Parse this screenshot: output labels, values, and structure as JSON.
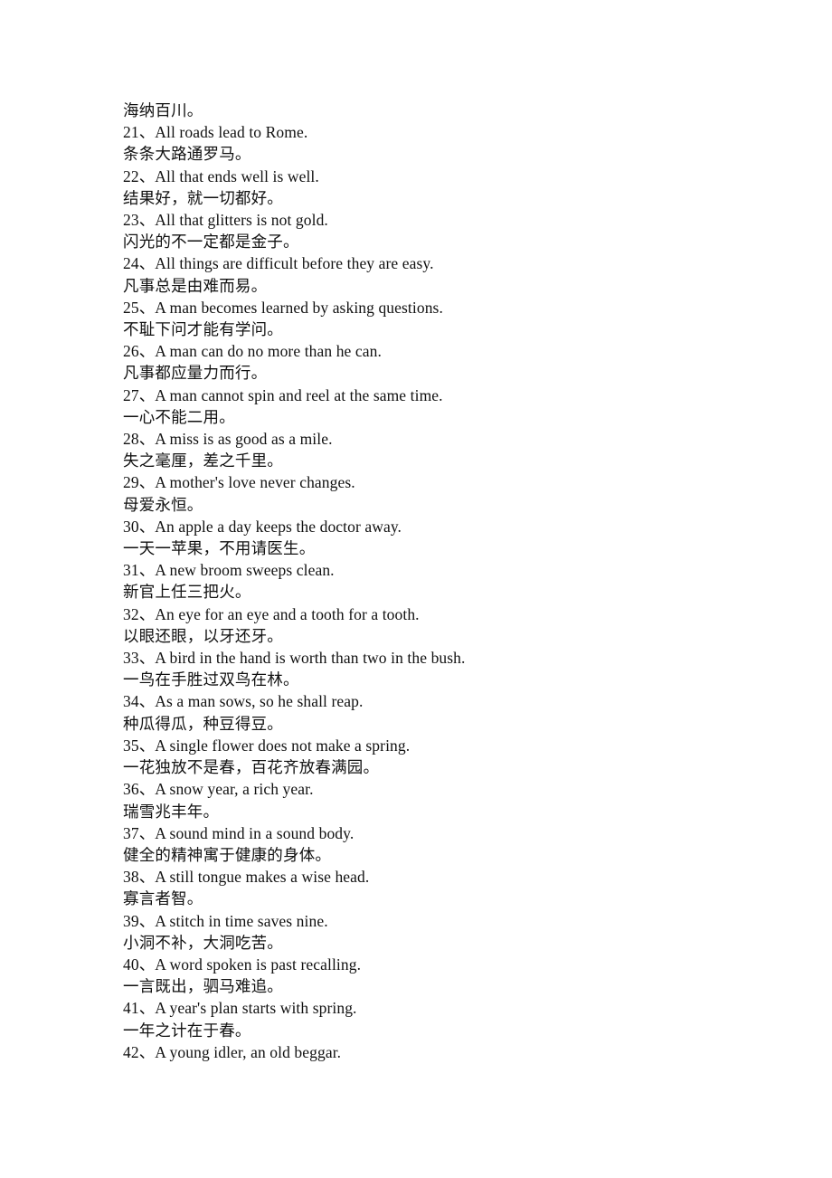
{
  "document": {
    "page_background": "#ffffff",
    "text_color": "#111111",
    "title": "English Proverbs with Chinese Translations (21-42)",
    "lines": [
      {
        "type": "zh",
        "text": "海纳百川。"
      },
      {
        "type": "en",
        "text": "21、All roads lead to Rome."
      },
      {
        "type": "zh",
        "text": "条条大路通罗马。"
      },
      {
        "type": "en",
        "text": "22、All that ends well is well."
      },
      {
        "type": "zh",
        "text": "结果好，就一切都好。"
      },
      {
        "type": "en",
        "text": "23、All that glitters is not gold."
      },
      {
        "type": "zh",
        "text": "闪光的不一定都是金子。"
      },
      {
        "type": "en",
        "text": "24、All things are difficult before they are easy."
      },
      {
        "type": "zh",
        "text": "凡事总是由难而易。"
      },
      {
        "type": "en",
        "text": "25、A man becomes learned by asking questions."
      },
      {
        "type": "zh",
        "text": "不耻下问才能有学问。"
      },
      {
        "type": "en",
        "text": "26、A man can do no more than he can."
      },
      {
        "type": "zh",
        "text": "凡事都应量力而行。"
      },
      {
        "type": "en",
        "text": "27、A man cannot spin and reel at the same time."
      },
      {
        "type": "zh",
        "text": "一心不能二用。"
      },
      {
        "type": "en",
        "text": "28、A miss is as good as a mile."
      },
      {
        "type": "zh",
        "text": "失之毫厘，差之千里。"
      },
      {
        "type": "en",
        "text": "29、A mother's love never changes."
      },
      {
        "type": "zh",
        "text": "母爱永恒。"
      },
      {
        "type": "en",
        "text": "30、An apple a day keeps the doctor away."
      },
      {
        "type": "zh",
        "text": "一天一苹果，不用请医生。"
      },
      {
        "type": "en",
        "text": "31、A new broom sweeps clean."
      },
      {
        "type": "zh",
        "text": "新官上任三把火。"
      },
      {
        "type": "en",
        "text": "32、An eye for an eye and a tooth for a tooth."
      },
      {
        "type": "zh",
        "text": "以眼还眼，以牙还牙。"
      },
      {
        "type": "en",
        "text": "33、A bird in the hand is worth than two in the bush."
      },
      {
        "type": "zh",
        "text": "一鸟在手胜过双鸟在林。"
      },
      {
        "type": "en",
        "text": "34、As a man sows, so he shall reap."
      },
      {
        "type": "zh",
        "text": "种瓜得瓜，种豆得豆。"
      },
      {
        "type": "en",
        "text": "35、A single flower does not make a spring."
      },
      {
        "type": "zh",
        "text": "一花独放不是春，百花齐放春满园。"
      },
      {
        "type": "en",
        "text": "36、A snow year, a rich year."
      },
      {
        "type": "zh",
        "text": "瑞雪兆丰年。"
      },
      {
        "type": "en",
        "text": "37、A sound mind in a sound body."
      },
      {
        "type": "zh",
        "text": "健全的精神寓于健康的身体。"
      },
      {
        "type": "en",
        "text": "38、A still tongue makes a wise head."
      },
      {
        "type": "zh",
        "text": "寡言者智。"
      },
      {
        "type": "en",
        "text": "39、A stitch in time saves nine."
      },
      {
        "type": "zh",
        "text": "小洞不补，大洞吃苦。"
      },
      {
        "type": "en",
        "text": "40、A word spoken is past recalling."
      },
      {
        "type": "zh",
        "text": "一言既出，驷马难追。"
      },
      {
        "type": "en",
        "text": "41、A year's plan starts with spring."
      },
      {
        "type": "zh",
        "text": "一年之计在于春。"
      },
      {
        "type": "en",
        "text": "42、A young idler, an old beggar."
      }
    ]
  }
}
